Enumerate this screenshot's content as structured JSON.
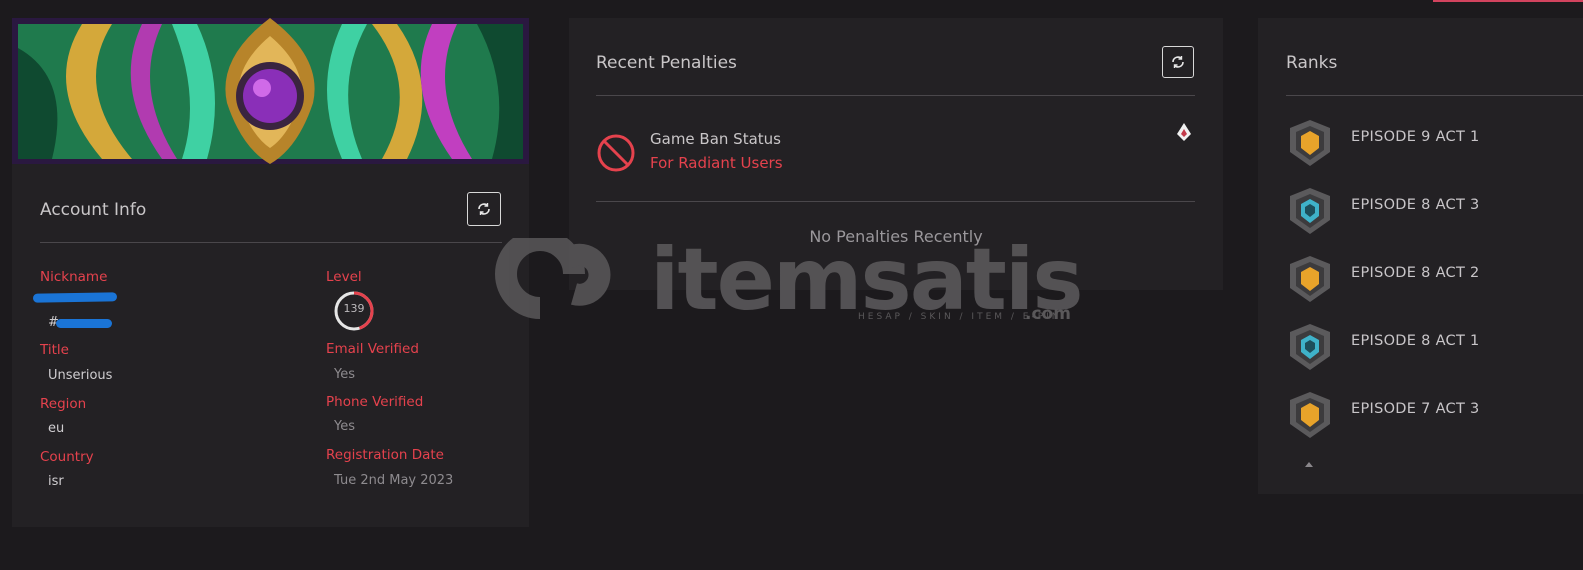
{
  "account": {
    "title": "Account Info",
    "nickname_label": "Nickname",
    "tag_value": "#",
    "level_label": "Level",
    "level_value": "139",
    "level_progress": 0.45,
    "title_label": "Title",
    "title_value": "Unserious",
    "email_label": "Email Verified",
    "email_value": "Yes",
    "region_label": "Region",
    "region_value": "eu",
    "phone_label": "Phone Verified",
    "phone_value": "Yes",
    "country_label": "Country",
    "country_value": "isr",
    "regdate_label": "Registration Date",
    "regdate_value": "Tue 2nd May 2023"
  },
  "penalties": {
    "title": "Recent Penalties",
    "ban_title": "Game Ban Status",
    "ban_sub": "For Radiant Users",
    "empty_text": "No Penalties Recently"
  },
  "ranks": {
    "title": "Ranks",
    "items": [
      {
        "label": "EPISODE 9 ACT 1",
        "icon": "gold-rank-icon"
      },
      {
        "label": "EPISODE 8 ACT 3",
        "icon": "diamond-rank-icon"
      },
      {
        "label": "EPISODE 8 ACT 2",
        "icon": "gold-rank-icon"
      },
      {
        "label": "EPISODE 8 ACT 1",
        "icon": "diamond-rank-icon"
      },
      {
        "label": "EPISODE 7 ACT 3",
        "icon": "gold-rank-icon"
      }
    ]
  },
  "watermark": {
    "brand": "itemsatis",
    "tagline": "HESAP / SKIN / ITEM / E-PIN",
    "suffix": ".com"
  },
  "colors": {
    "accent_red": "#e5424d",
    "gold": "#e8a32a",
    "diamond": "#3fb2c9",
    "background": "#1c1a1d",
    "card": "#232124"
  }
}
